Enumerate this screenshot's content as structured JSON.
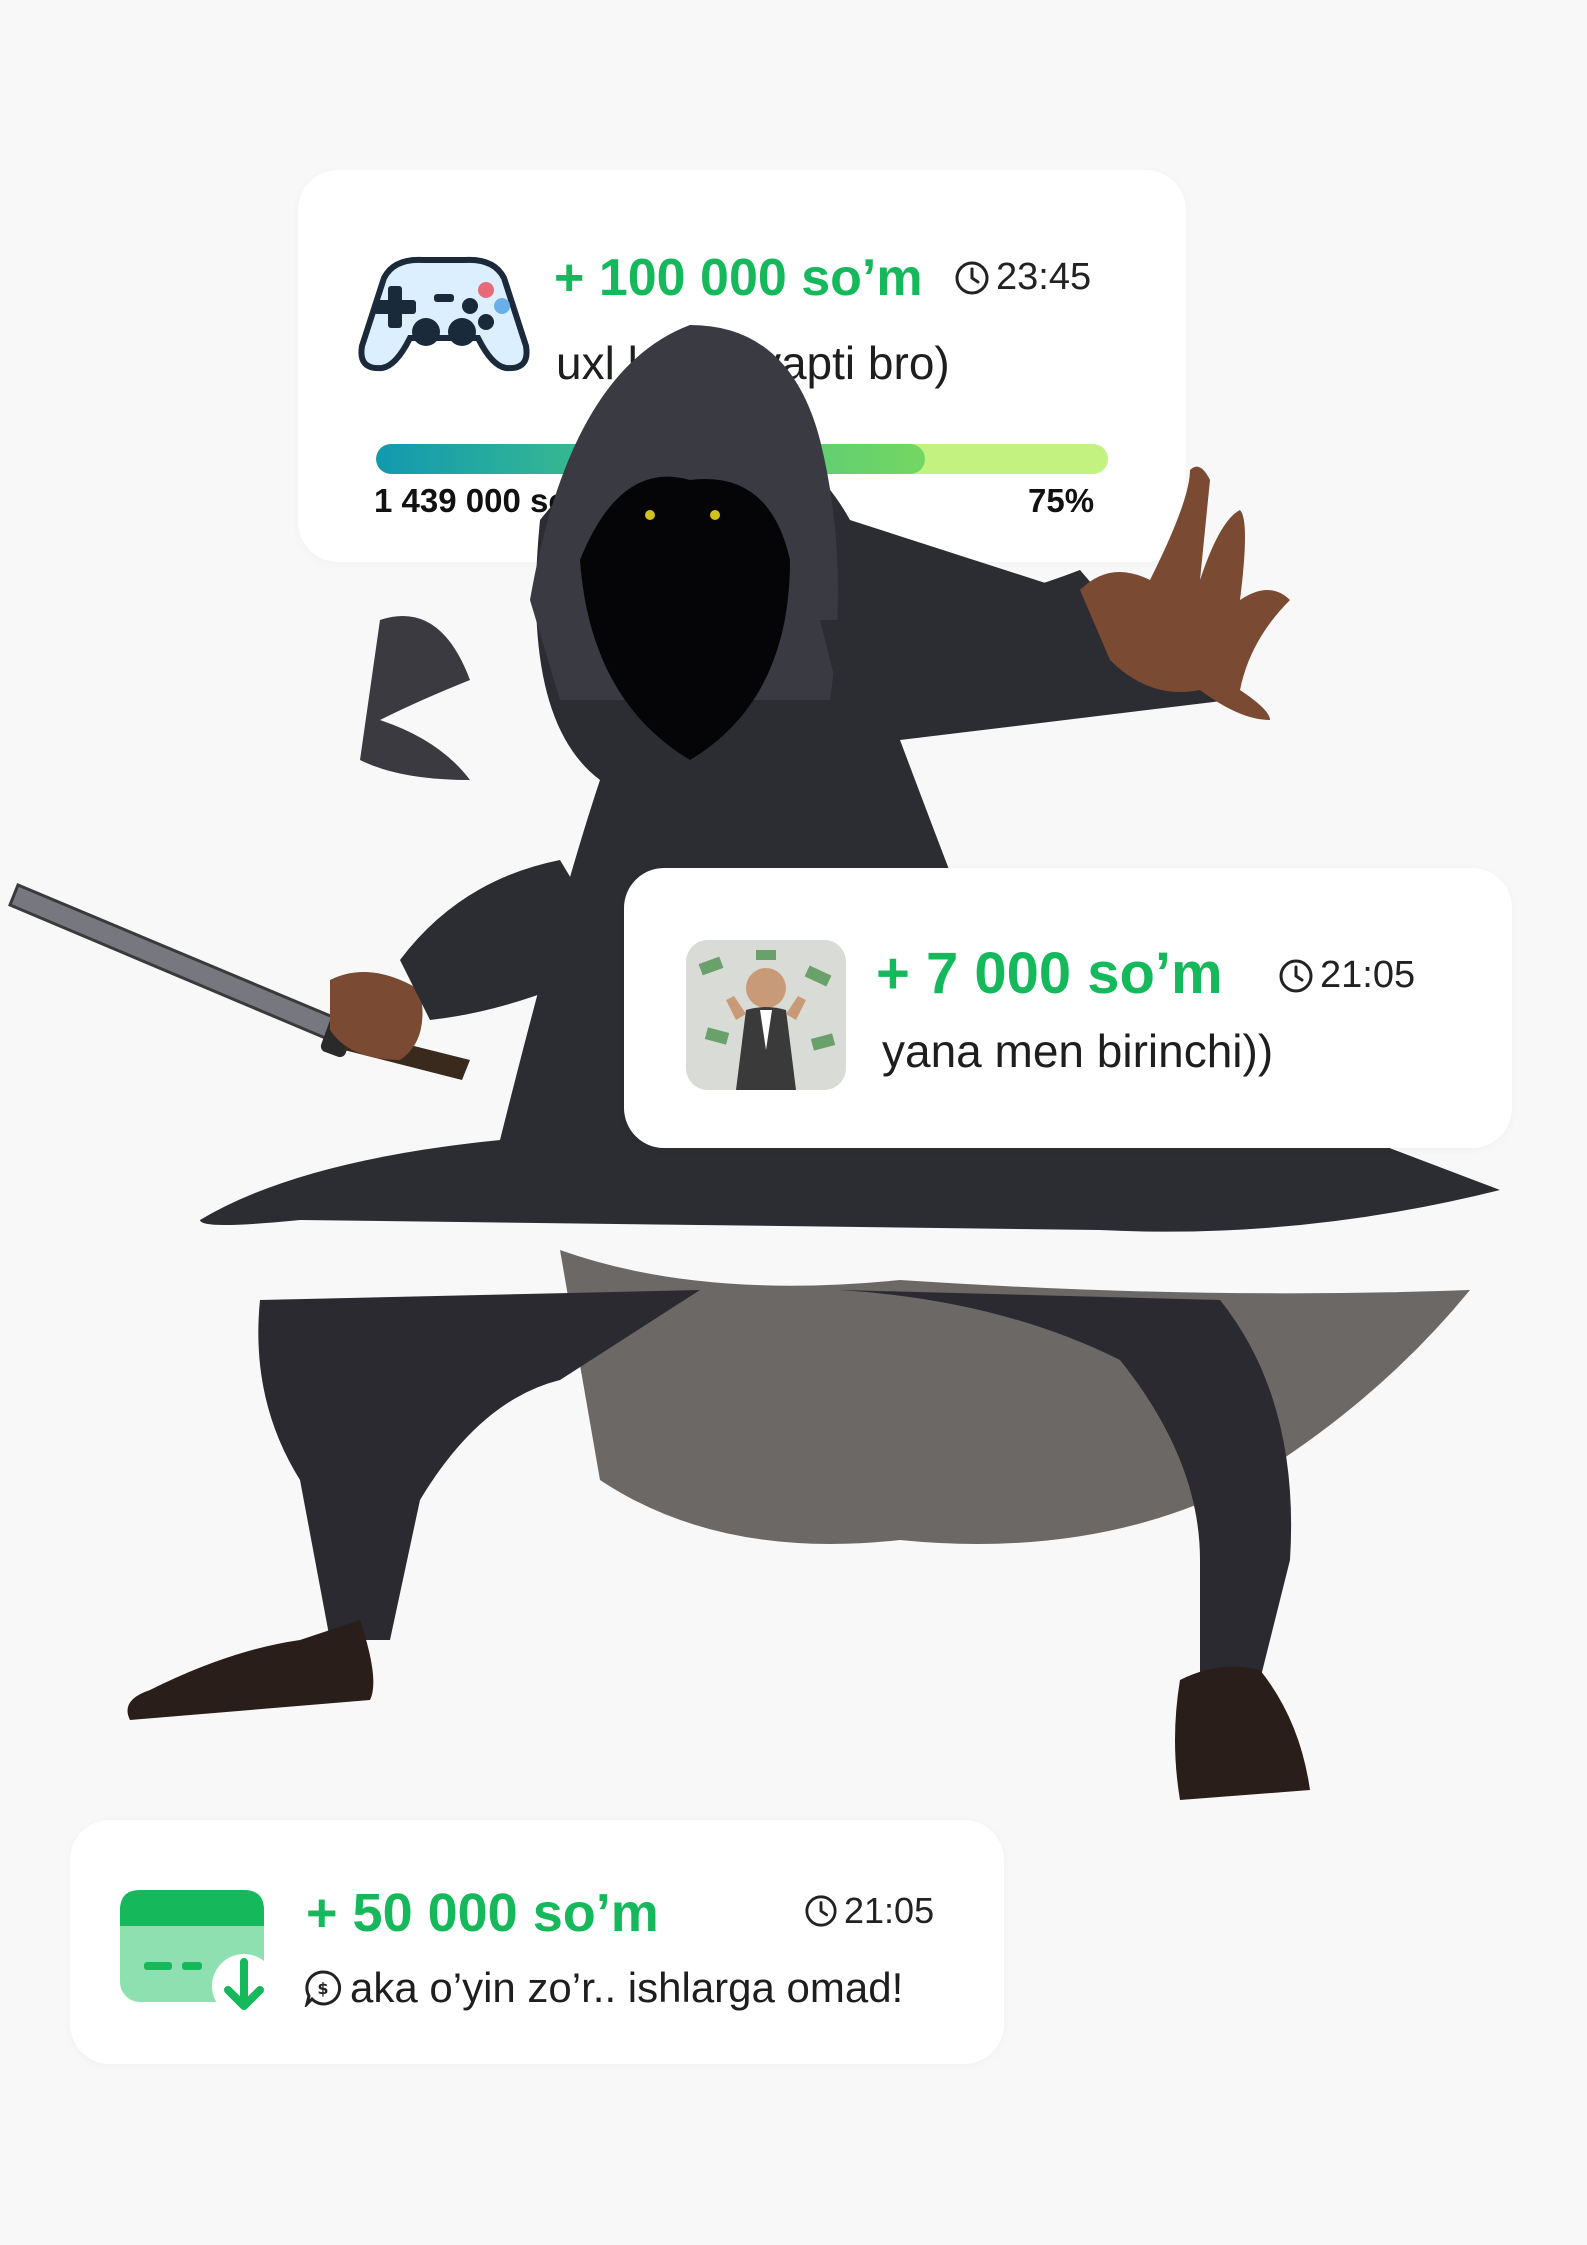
{
  "card1": {
    "amount": "+ 100 000 so’m",
    "time": "23:45",
    "message": "uxl    kechikyapti bro)",
    "progress_left": "1 439 000 so",
    "progress_right": "75%",
    "progress_fraction": 0.75,
    "icon": "gamepad-icon"
  },
  "card2": {
    "amount": "+ 7 000 so’m",
    "time": "21:05",
    "message": "yana men birinchi))",
    "icon": "money-rain-avatar"
  },
  "card3": {
    "amount": "+ 50 000 so’m",
    "time": "21:05",
    "message": "aka o’yin zo’r.. ishlarga omad!",
    "icon": "card-download-icon"
  },
  "colors": {
    "accent": "#16b85c",
    "background": "#f8f8f8",
    "card": "#ffffff"
  }
}
